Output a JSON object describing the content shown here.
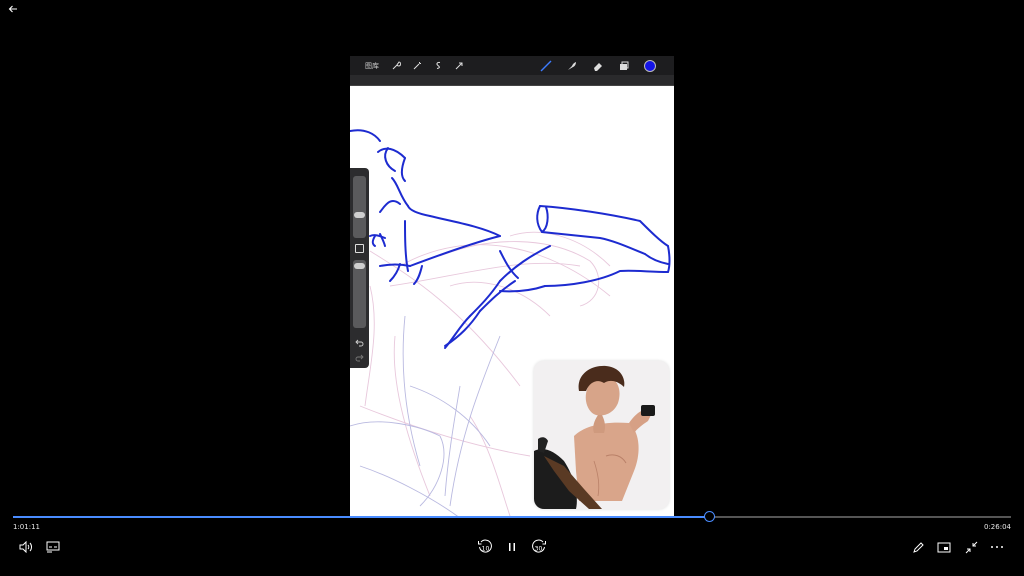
{
  "player": {
    "time_elapsed": "1:01:11",
    "time_remaining": "0:26:04",
    "progress": 0.698,
    "accent_color": "#4a8cff",
    "skip_back_seconds": "10",
    "skip_forward_seconds": "30",
    "state": "playing"
  },
  "app_toolbar": {
    "gallery_label": "图库",
    "active_color": "#1414e6",
    "left_icons": [
      "wrench-icon",
      "magic-wand-icon",
      "selection-icon",
      "transform-arrow-icon"
    ],
    "right_icons": [
      "brush-icon",
      "smudge-icon",
      "eraser-icon",
      "layers-icon",
      "color-swatch"
    ]
  },
  "side_panel": {
    "brush_size": 0.35,
    "opacity": 0.05
  },
  "icons": {
    "back": "back-arrow-icon",
    "volume": "volume-icon",
    "captions": "captions-icon",
    "replay": "replay-10-icon",
    "pause": "pause-icon",
    "forward": "forward-30-icon",
    "edit": "pencil-icon",
    "miniplayer": "miniplayer-icon",
    "exit_fullscreen": "exit-fullscreen-icon",
    "more": "more-options-icon"
  }
}
